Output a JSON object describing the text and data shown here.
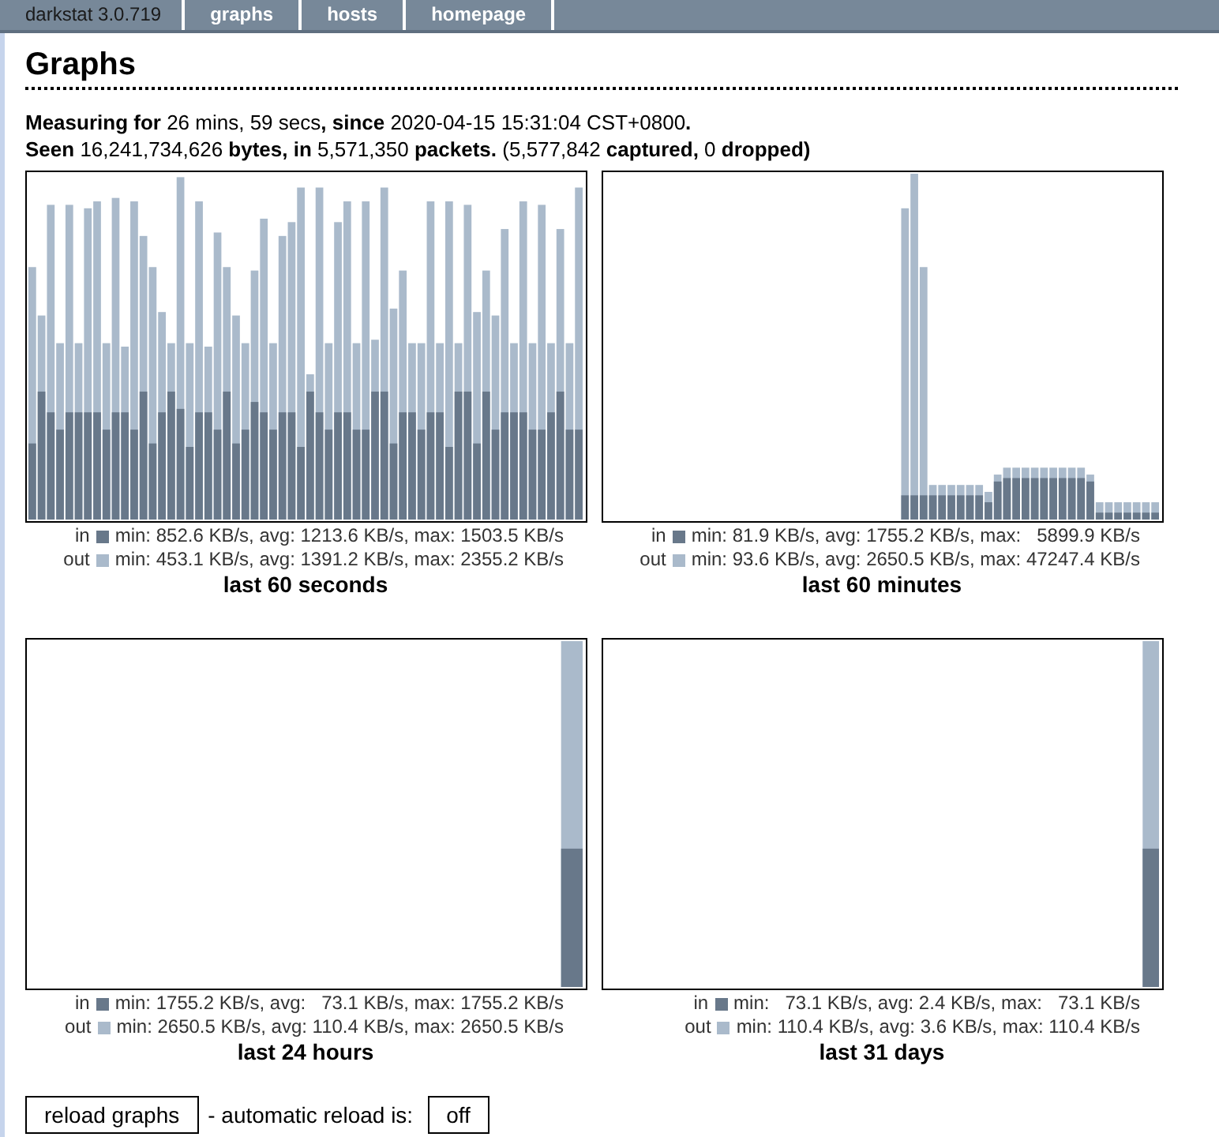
{
  "nav": [
    {
      "label": "darkstat 3.0.719",
      "kind": "brand"
    },
    {
      "label": "graphs",
      "kind": "link"
    },
    {
      "label": "hosts",
      "kind": "link"
    },
    {
      "label": "homepage",
      "kind": "link"
    }
  ],
  "title": "Graphs",
  "summary": [
    "**Measuring for** 26 mins, 59 secs**, since** 2020-04-15 15:31:04 CST+0800**.**",
    "**Seen** 16,241,734,626 **bytes, in** 5,571,350 **packets.** (5,577,842 **captured,** 0 **dropped)**"
  ],
  "graphs": [
    {
      "kind": "seconds",
      "caption": "last 60 seconds",
      "legend": [
        {
          "kind": "in",
          "label": "in",
          "text": "min: 852.6 KB/s, avg: 1213.6 KB/s, max: 1503.5 KB/s"
        },
        {
          "kind": "out",
          "label": "out",
          "text": "min: 453.1 KB/s, avg: 1391.2 KB/s, max: 2355.2 KB/s"
        }
      ]
    },
    {
      "kind": "minutes",
      "caption": "last 60 minutes",
      "legend": [
        {
          "kind": "in",
          "label": "in",
          "text": "min: 81.9 KB/s, avg: 1755.2 KB/s, max:   5899.9 KB/s"
        },
        {
          "kind": "out",
          "label": "out",
          "text": "min: 93.6 KB/s, avg: 2650.5 KB/s, max: 47247.4 KB/s"
        }
      ]
    },
    {
      "kind": "hours",
      "caption": "last 24 hours",
      "legend": [
        {
          "kind": "in",
          "label": "in",
          "text": "min: 1755.2 KB/s, avg:   73.1 KB/s, max: 1755.2 KB/s"
        },
        {
          "kind": "out",
          "label": "out",
          "text": "min: 2650.5 KB/s, avg: 110.4 KB/s, max: 2650.5 KB/s"
        }
      ]
    },
    {
      "kind": "days",
      "caption": "last 31 days",
      "legend": [
        {
          "kind": "in",
          "label": "in",
          "text": "min:   73.1 KB/s, avg: 2.4 KB/s, max:   73.1 KB/s"
        },
        {
          "kind": "out",
          "label": "out",
          "text": "min: 110.4 KB/s, avg: 3.6 KB/s, max: 110.4 KB/s"
        }
      ]
    }
  ],
  "reload_button": "reload graphs",
  "auto_reload_label": "- automatic reload is:",
  "auto_reload_button": "off"
}
